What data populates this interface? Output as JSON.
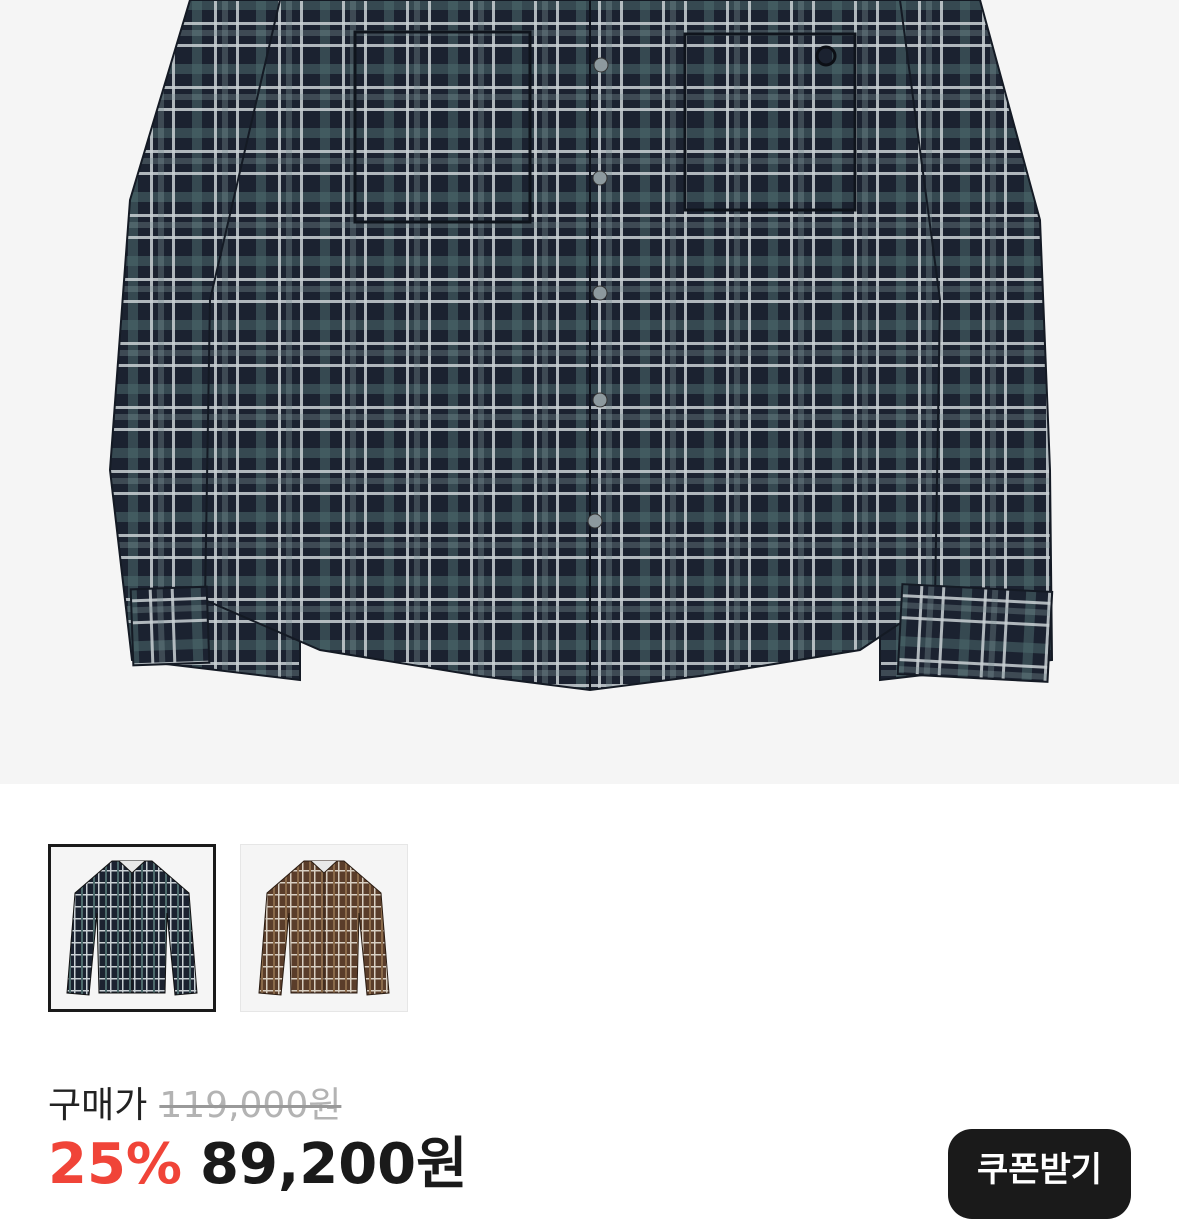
{
  "product": {
    "thumbnails": [
      {
        "name": "navy-plaid-shirt-thumbnail",
        "selected": true,
        "colors": {
          "base": "#1b2230",
          "check": "#c9d0d4",
          "accent": "#4d6a6c"
        }
      },
      {
        "name": "brown-plaid-shirt-thumbnail",
        "selected": false,
        "colors": {
          "base": "#5a3d2a",
          "check": "#d8cfc2",
          "accent": "#8a6a4a"
        }
      }
    ],
    "hero_colors": {
      "background": "#f5f5f5",
      "base": "#1b2230",
      "check": "#c9d0d4",
      "accent": "#4d6a6c"
    }
  },
  "price": {
    "label": "구매가",
    "original": "119,000원",
    "discount": "25%",
    "sale": "89,200원"
  },
  "coupon": {
    "label": "쿠폰받기"
  },
  "colors": {
    "discount": "#f04438",
    "button_bg": "#1a1a1a",
    "strike": "#b3b3b3"
  }
}
